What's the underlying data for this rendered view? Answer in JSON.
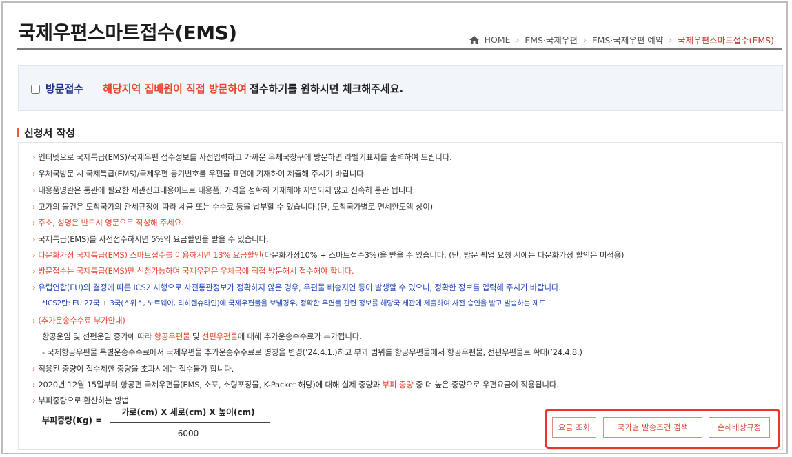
{
  "header": {
    "title": "국제우편스마트접수(EMS)",
    "breadcrumb": [
      "HOME",
      "EMS·국제우편",
      "EMS·국제우편 예약",
      "국제우편스마트접수(EMS)"
    ]
  },
  "visit": {
    "label": "방문접수",
    "highlight": "해당지역 집배원이 직접 방문하여",
    "text": "접수하기를 원하시면 체크해주세요."
  },
  "section": {
    "title": "신청서 작성"
  },
  "info": {
    "l1": "인터넷으로 국제특급(EMS)/국제우편 접수정보를 사전입력하고 가까운 우체국창구에 방문하면 라벨기표지를 출력하여 드립니다.",
    "l2": "우체국방문 시 국제특급(EMS)/국제우편 등기번호를 우편물 표면에 기재하여 제출해 주시기 바랍니다.",
    "l3": "내용품명란은 통관에 필요한 세관신고내용이므로 내용품, 가격을 정확히 기재해야 지연되지 않고 신속히 통관 됩니다.",
    "l4": "고가의 물건은 도착국가의 관세규정에 따라 세금 또는 수수료 등을 납부할 수 있습니다.(단, 도착국가별로 면세한도액 상이)",
    "l5": "주소, 성명은 반드시 영문으로 작성해 주세요.",
    "l6": "국제특급(EMS)를 사전접수하시면 5%의 요금할인을 받을 수 있습니다.",
    "l7_red": "다문화가정 국제특급(EMS) 스마트접수를 이용하시면 13% 요금할인",
    "l7_rest": "(다문화가정10% + 스마트접수3%)을 받을 수 있습니다. (단, 방문 픽업 요청 시에는 다문화가정 할인은 미적용)",
    "l8": "방문접수는 국제특급(EMS)만 신청가능하며 국제우편은 우체국에 직접 방문해서 접수해야 합니다.",
    "l9": "유럽연합(EU)의 결정에 따른 ICS2 시행으로 사전통관정보가 정확하지 않은 경우, 우편물 배송지연 등이 발생할 수 있으니, 정확한 정보를 입력해 주시기 바랍니다.",
    "l10": "*ICS2란: EU 27국 + 3국(스위스, 노르웨이, 리히텐슈타인)에 국제우편물을 보낼경우, 정확한 우편물 관련 정보를 해당국 세관에 제출하여 사전 승인을 받고 발송하는 제도",
    "l11": "(추가운송수수료 부가안내)",
    "l12_a": "항공운임 및 선편운임 증가에 따라 ",
    "l12_b": "항공우편물",
    "l12_c": " 및 ",
    "l12_d": "선편우편물",
    "l12_e": "에 대해 추가운송수수료가 부가됩니다.",
    "l13": "- 국제항공우편물 특별운송수수료에서 국제우편물 추가운송수수료로 명칭을 변경(’24.4.1.)하고 부과 범위를 항공우편물에서 항공우편물, 선편우편물로 확대(’24.4.8.)",
    "l14": "적용된 중량이 접수제한 중량을 초과시에는 접수불가 합니다.",
    "l15_a": "2020년 12월 15일부터 항공편 국제우편물(EMS, 소포, 소형포장물, K-Packet 해당)에 대해 실제 중량과 ",
    "l15_b": "부피 중량",
    "l15_c": " 중 더 높은 중량으로 우편요금이 적용됩니다.",
    "l16": "부피중량으로 환산하는 방법"
  },
  "formula": {
    "label": "부피중량(Kg) =",
    "numerator": "가로(cm) X 세로(cm) X 높이(cm)",
    "denominator": "6000"
  },
  "buttons": {
    "fee": "요금 조회",
    "country": "국가별 발송조건 검색",
    "compensation": "손해배상규정"
  },
  "colors": {
    "accent_red": "#e8442f",
    "link_blue": "#2447b8",
    "title_blue": "#1f2d8a",
    "highlight_border": "#e8352a"
  }
}
